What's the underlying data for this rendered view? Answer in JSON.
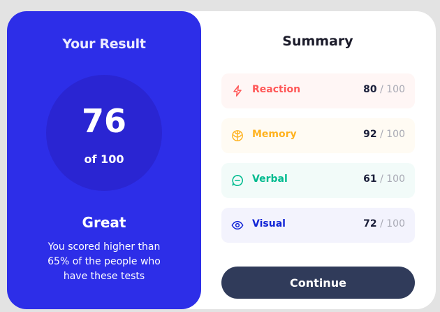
{
  "result": {
    "title": "Your Result",
    "score": "76",
    "of_label": "of 100",
    "rating": "Great",
    "description": "You scored higher than 65% of the people who have these tests"
  },
  "summary": {
    "title": "Summary",
    "items": [
      {
        "label": "Reaction",
        "score": "80",
        "max": "/ 100",
        "icon": "lightning-icon",
        "color": "#ff5757",
        "bg": "#fff6f5"
      },
      {
        "label": "Memory",
        "score": "92",
        "max": "/ 100",
        "icon": "brain-icon",
        "color": "#ffb21e",
        "bg": "#fffbf3"
      },
      {
        "label": "Verbal",
        "score": "61",
        "max": "/ 100",
        "icon": "chat-icon",
        "color": "#00bb8f",
        "bg": "#f2fbf9"
      },
      {
        "label": "Visual",
        "score": "72",
        "max": "/ 100",
        "icon": "eye-icon",
        "color": "#1125d6",
        "bg": "#f3f3fd"
      }
    ]
  },
  "button": {
    "continue_label": "Continue"
  }
}
